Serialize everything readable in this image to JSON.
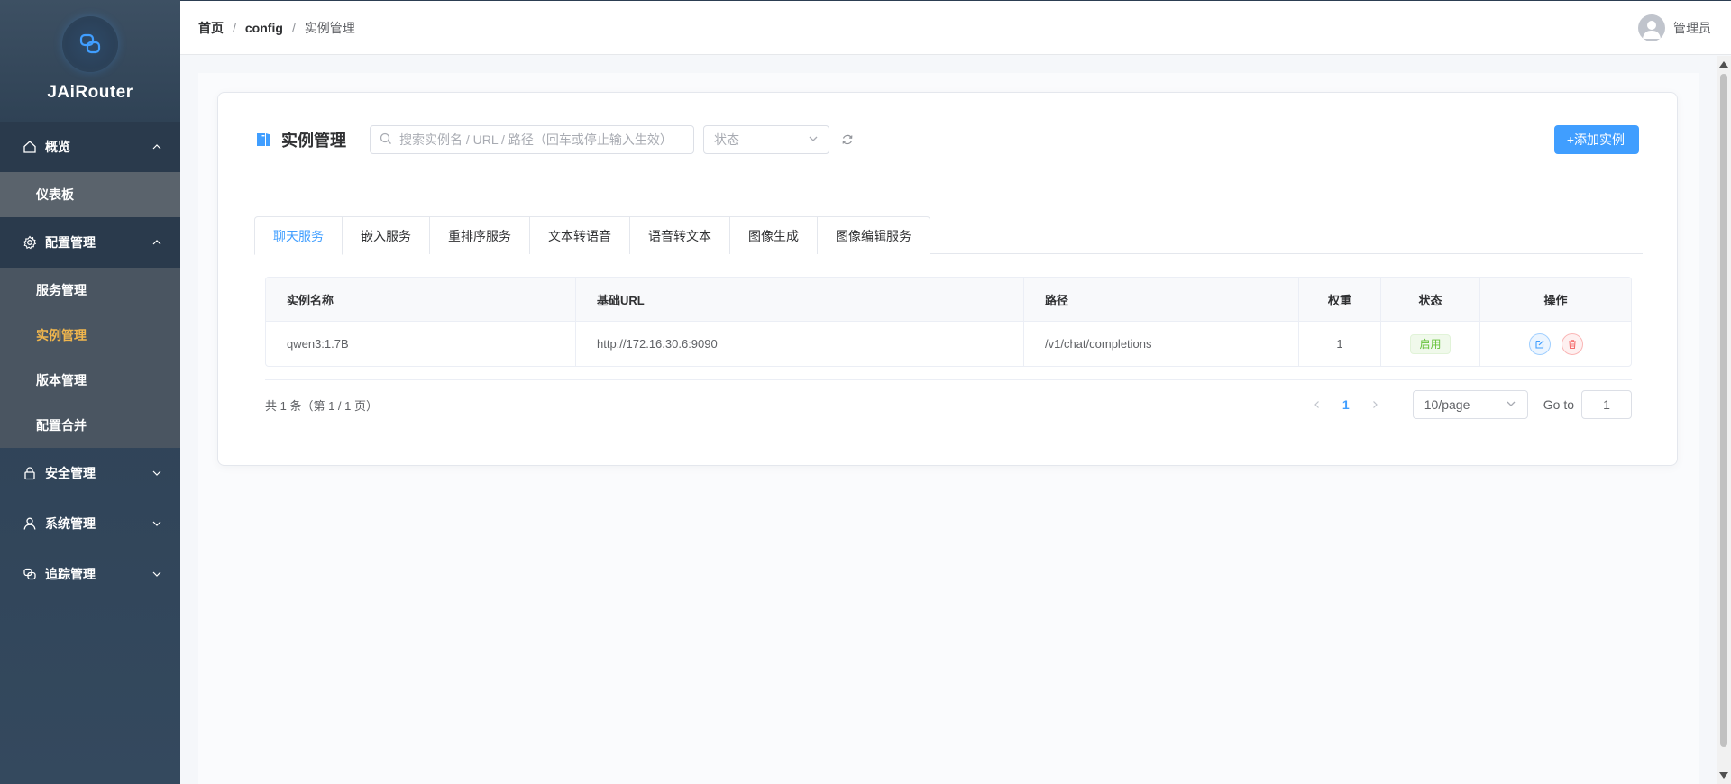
{
  "colors": {
    "accent": "#409eff",
    "sidebar": "#2c3e52",
    "active_menu": "#f0b64d",
    "success": "#67c23a",
    "danger": "#f56c6c"
  },
  "app": {
    "name": "JAiRouter"
  },
  "sidebar": {
    "groups": [
      {
        "label": "概览",
        "icon": "home-icon",
        "expanded": true,
        "items": [
          {
            "label": "仪表板"
          }
        ]
      },
      {
        "label": "配置管理",
        "icon": "gear-icon",
        "expanded": true,
        "items": [
          {
            "label": "服务管理"
          },
          {
            "label": "实例管理",
            "active": true
          },
          {
            "label": "版本管理"
          },
          {
            "label": "配置合并"
          }
        ]
      },
      {
        "label": "安全管理",
        "icon": "lock-icon",
        "expanded": false
      },
      {
        "label": "系统管理",
        "icon": "user-icon",
        "expanded": false
      },
      {
        "label": "追踪管理",
        "icon": "trace-icon",
        "expanded": false
      }
    ]
  },
  "header": {
    "breadcrumb": [
      "首页",
      "config",
      "实例管理"
    ],
    "user": "管理员"
  },
  "card": {
    "title": "实例管理",
    "search_placeholder": "搜索实例名 / URL / 路径（回车或停止输入生效）",
    "status_placeholder": "状态",
    "add_button": "+添加实例"
  },
  "tabs": [
    "聊天服务",
    "嵌入服务",
    "重排序服务",
    "文本转语音",
    "语音转文本",
    "图像生成",
    "图像编辑服务"
  ],
  "table": {
    "columns": [
      "实例名称",
      "基础URL",
      "路径",
      "权重",
      "状态",
      "操作"
    ],
    "rows": [
      {
        "name": "qwen3:1.7B",
        "base_url": "http://172.16.30.6:9090",
        "path": "/v1/chat/completions",
        "weight": "1",
        "status": "启用"
      }
    ]
  },
  "pagination": {
    "total_text": "共 1 条（第 1 / 1 页）",
    "current_page": "1",
    "page_size": "10/page",
    "goto_label": "Go to",
    "goto_value": "1"
  }
}
